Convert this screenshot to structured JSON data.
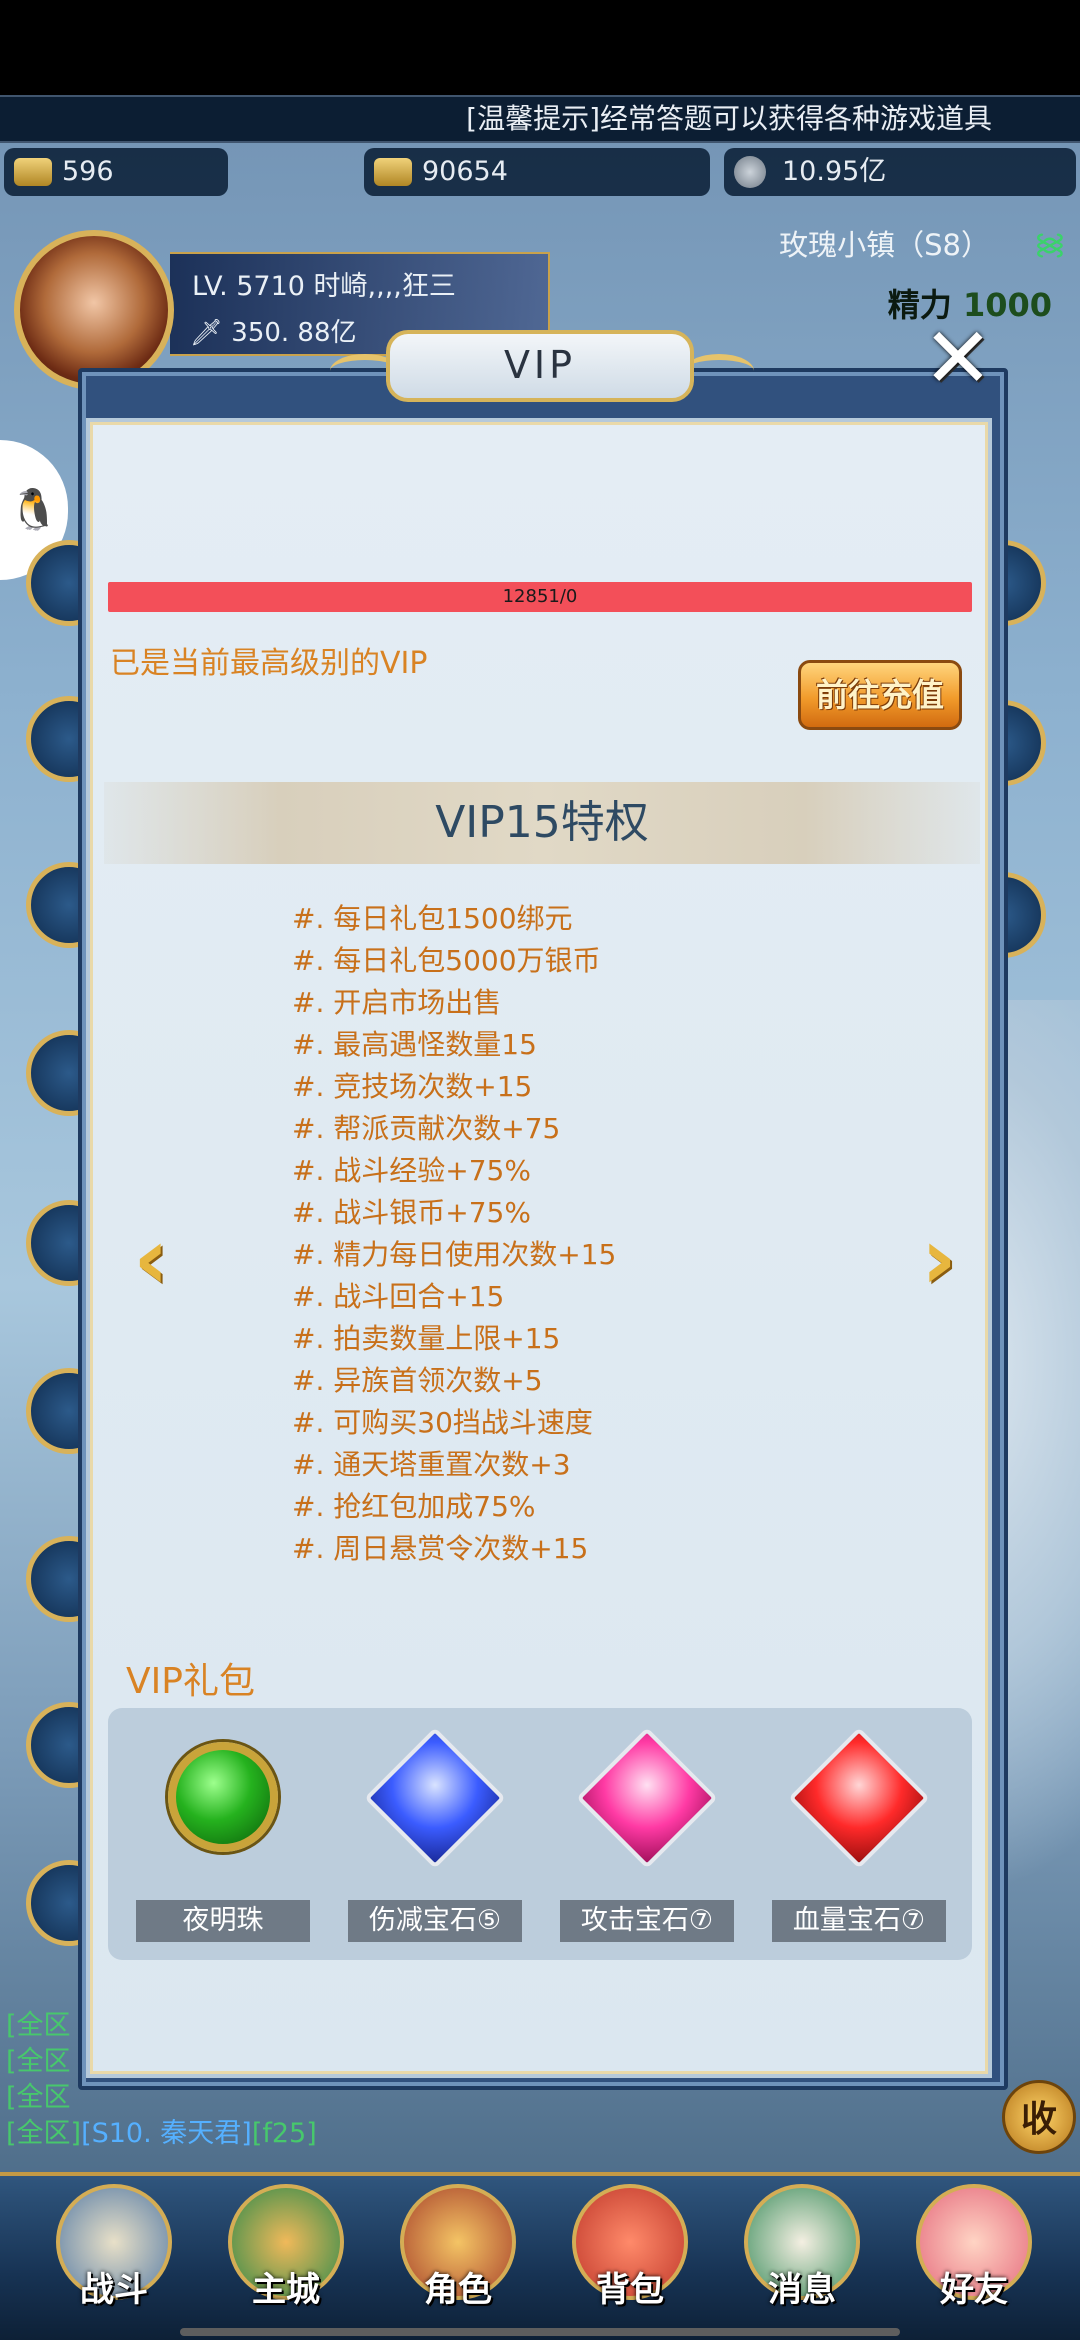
{
  "notice": "[温馨提示]经常答题可以获得各种游戏道具",
  "resources": [
    {
      "icon": "gold-ingot-icon",
      "value": "596"
    },
    {
      "icon": "bound-gold-icon",
      "value": "90654"
    },
    {
      "icon": "silver-coin-icon",
      "value": "10.95亿"
    }
  ],
  "server": "玫瑰小镇（S8）",
  "energy": {
    "label": "精力",
    "value": "1000"
  },
  "player": {
    "level_name": "LV. 5710 时崎,,,,狂三",
    "power": "350. 88亿"
  },
  "dialog": {
    "title": "VIP",
    "exp_text": "12851/0",
    "max_level_text": "已是当前最高级别的VIP",
    "recharge_label": "前往充值",
    "section_title": "VIP15特权",
    "privileges": [
      "#. 每日礼包1500绑元",
      "#. 每日礼包5000万银币",
      "#. 开启市场出售",
      "#. 最高遇怪数量15",
      "#. 竞技场次数+15",
      "#. 帮派贡献次数+75",
      "#. 战斗经验+75%",
      "#. 战斗银币+75%",
      "#. 精力每日使用次数+15",
      "#. 战斗回合+15",
      "#. 拍卖数量上限+15",
      "#. 异族首领次数+5",
      "#. 可购买30挡战斗速度",
      "#. 通天塔重置次数+3",
      "#. 抢红包加成75%",
      "#. 周日悬赏令次数+15"
    ],
    "gift_title": "VIP礼包",
    "gifts": [
      {
        "name": "夜明珠",
        "icon": "night-pearl-icon"
      },
      {
        "name": "伤减宝石⑤",
        "icon": "blue-gem-icon",
        "color": "#3b5cff"
      },
      {
        "name": "攻击宝石⑦",
        "icon": "pink-gem-icon",
        "color": "#ff3aa4"
      },
      {
        "name": "血量宝石⑦",
        "icon": "red-gem-icon",
        "color": "#ff2a2a"
      }
    ]
  },
  "chat": {
    "lines": [
      "[全区",
      "[全区",
      "[全区"
    ],
    "last_line_prefix": "[全区]",
    "last_line_name": "[S10. 秦天君]",
    "last_line_msg": "[f25]"
  },
  "collapse_label": "收",
  "nav": [
    "战斗",
    "主城",
    "角色",
    "背包",
    "消息",
    "好友"
  ]
}
